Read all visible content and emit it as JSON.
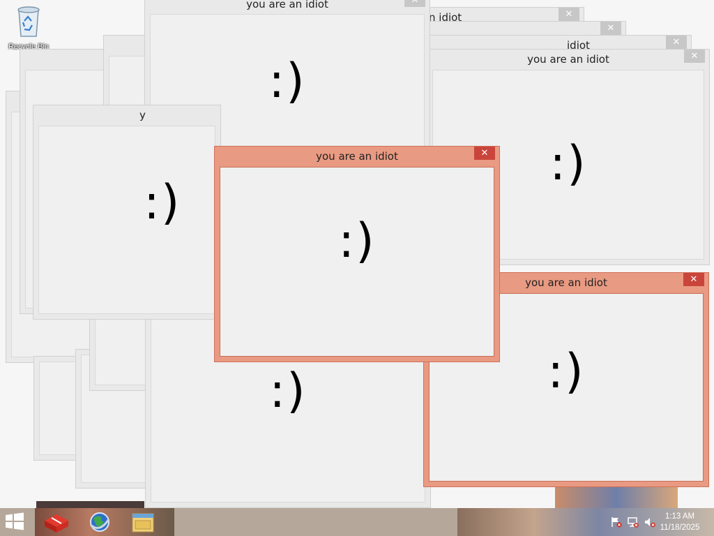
{
  "desktop": {
    "recycle_bin_label": "Recycle Bin"
  },
  "popup": {
    "title": "you are an idiot",
    "message": ":)",
    "close_glyph": "✕"
  },
  "taskbar": {
    "start_icon": "windows-logo-icon",
    "apps": [
      {
        "icon": "red-package-app-icon"
      },
      {
        "icon": "browser-globe-icon"
      },
      {
        "icon": "file-explorer-icon"
      }
    ],
    "tray_icons": [
      "action-center-flag-icon",
      "network-icon",
      "speaker-muted-icon"
    ],
    "time": "1:13 AM",
    "date": "11/18/2025"
  },
  "colors": {
    "active_frame": "#e99a82",
    "active_close": "#c9453c",
    "inactive_frame": "#e9e9e9"
  }
}
